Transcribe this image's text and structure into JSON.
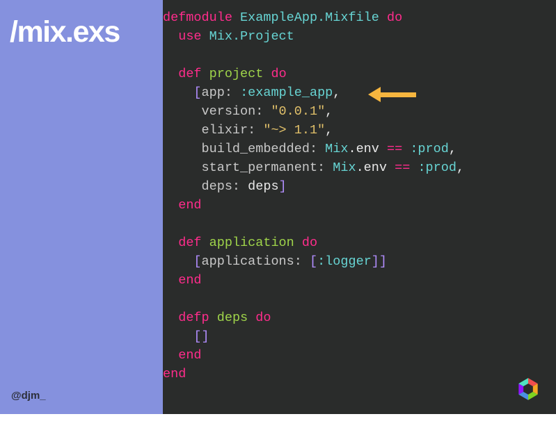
{
  "sidebar": {
    "title": "/mix.exs",
    "handle": "@djm_"
  },
  "code": {
    "l1": {
      "a": "defmodule",
      "b": "ExampleApp.Mixfile",
      "c": "do"
    },
    "l2": {
      "a": "use",
      "b": "Mix.Project"
    },
    "l3": {
      "a": "def",
      "b": "project",
      "c": "do"
    },
    "l4": {
      "a": "[",
      "b": "app:",
      "c": ":example_app",
      "d": ","
    },
    "l5": {
      "a": "version:",
      "b": "\"0.0.1\"",
      "c": ","
    },
    "l6": {
      "a": "elixir:",
      "b": "\"~> 1.1\"",
      "c": ","
    },
    "l7": {
      "a": "build_embedded:",
      "b": "Mix",
      "c": ".env",
      "d": "==",
      "e": ":prod",
      "f": ","
    },
    "l8": {
      "a": "start_permanent:",
      "b": "Mix",
      "c": ".env",
      "d": "==",
      "e": ":prod",
      "f": ","
    },
    "l9": {
      "a": "deps:",
      "b": "deps",
      "c": "]"
    },
    "l10": {
      "a": "end"
    },
    "l11": {
      "a": "def",
      "b": "application",
      "c": "do"
    },
    "l12": {
      "a": "[",
      "b": "applications:",
      "c": "[",
      "d": ":logger",
      "e": "]",
      "f": "]"
    },
    "l13": {
      "a": "end"
    },
    "l14": {
      "a": "defp",
      "b": "deps",
      "c": "do"
    },
    "l15": {
      "a": "[",
      "b": "]"
    },
    "l16": {
      "a": "end"
    },
    "l17": {
      "a": "end"
    }
  }
}
